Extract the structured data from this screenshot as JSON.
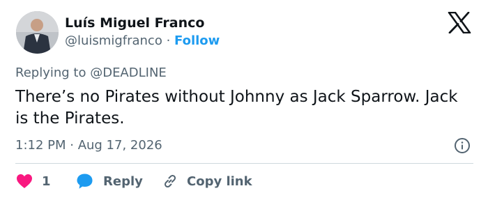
{
  "author": {
    "name": "Luís Miguel Franco",
    "handle": "@luismigfranco",
    "separator": " · ",
    "follow_label": "Follow"
  },
  "reply_context": {
    "prefix": "Replying to ",
    "mention": "@DEADLINE"
  },
  "tweet": {
    "text": "There’s no Pirates without Johnny as Jack Sparrow. Jack is the Pirates.",
    "timestamp": "1:12 PM · Aug 17, 2026"
  },
  "actions": {
    "like_count": "1",
    "reply_label": "Reply",
    "copy_link_label": "Copy link"
  },
  "icons": {
    "logo": "x-logo-icon",
    "info": "info-icon",
    "like": "heart-icon",
    "reply": "speech-bubble-icon",
    "copy": "link-icon"
  },
  "colors": {
    "accent": "#1d9bf0",
    "like": "#f91880",
    "text": "#0f1419",
    "secondary": "#536471",
    "divider": "#cfd9de"
  }
}
